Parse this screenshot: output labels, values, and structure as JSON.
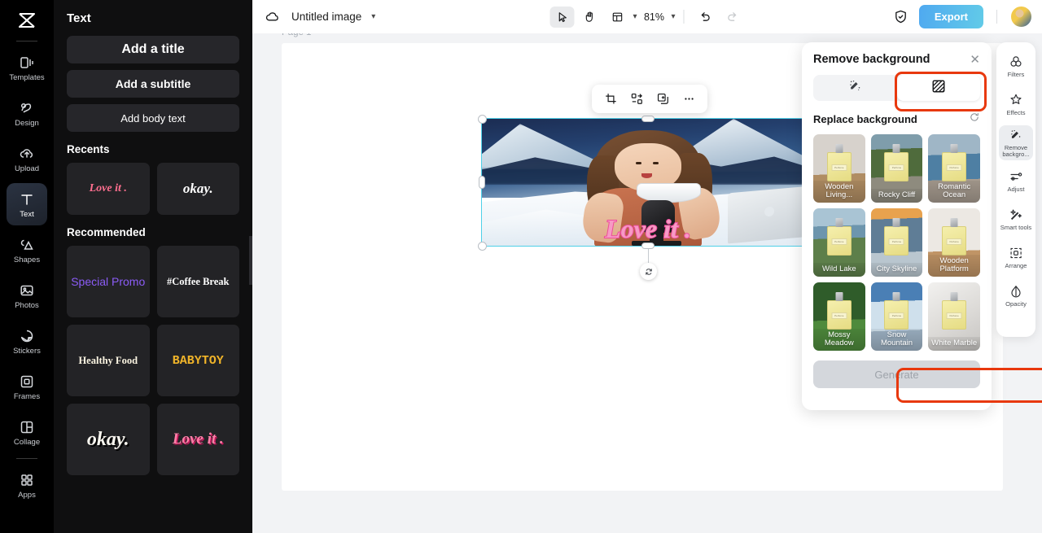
{
  "sidebar": {
    "logo_icon": "capcut-logo-icon",
    "items": [
      {
        "label": "Templates",
        "icon": "templates-icon",
        "active": false
      },
      {
        "label": "Design",
        "icon": "design-icon",
        "active": false
      },
      {
        "label": "Upload",
        "icon": "upload-cloud-icon",
        "active": false
      },
      {
        "label": "Text",
        "icon": "text-icon",
        "active": true
      },
      {
        "label": "Shapes",
        "icon": "shapes-icon",
        "active": false
      },
      {
        "label": "Photos",
        "icon": "photos-icon",
        "active": false
      },
      {
        "label": "Stickers",
        "icon": "stickers-icon",
        "active": false
      },
      {
        "label": "Frames",
        "icon": "frames-icon",
        "active": false
      },
      {
        "label": "Collage",
        "icon": "collage-icon",
        "active": false
      },
      {
        "label": "Apps",
        "icon": "apps-grid-icon",
        "active": false
      }
    ]
  },
  "text_panel": {
    "title": "Text",
    "buttons": [
      {
        "label": "Add a title"
      },
      {
        "label": "Add a subtitle"
      },
      {
        "label": "Add body text"
      }
    ],
    "recents_heading": "Recents",
    "recents": [
      {
        "label": "Love it .",
        "style": "pink-serif-italic"
      },
      {
        "label": "okay.",
        "style": "white-serif-italic"
      }
    ],
    "recommended_heading": "Recommended",
    "recommended": [
      {
        "label": "Special Promo",
        "style": "purple"
      },
      {
        "label": "#Coffee Break",
        "style": "white-serif"
      },
      {
        "label": "Healthy Food",
        "style": "cream-serif"
      },
      {
        "label": "BABYTOY",
        "style": "yellow-block"
      },
      {
        "label": "okay.",
        "style": "white-shadow-serif"
      },
      {
        "label": "Love it .",
        "style": "pink-shadow-serif"
      }
    ],
    "collapse_icon": "chevron-left-icon"
  },
  "topbar": {
    "cloud_icon": "cloud-save-icon",
    "doc_title": "Untitled image",
    "title_chevron_icon": "chevron-down-icon",
    "tools": [
      {
        "name": "select-tool",
        "icon": "cursor-arrow-icon",
        "selected": true
      },
      {
        "name": "hand-tool",
        "icon": "hand-icon",
        "selected": false
      },
      {
        "name": "layout-tool",
        "icon": "layout-panel-icon",
        "selected": false
      }
    ],
    "layout_chevron_icon": "chevron-down-icon",
    "zoom_level": "81%",
    "zoom_chevron_icon": "chevron-down-icon",
    "undo_icon": "undo-arrow-icon",
    "redo_icon": "redo-arrow-icon",
    "shield_icon": "shield-check-icon",
    "export_label": "Export",
    "avatar_icon": "user-avatar"
  },
  "canvas": {
    "page_label": "Page 1",
    "element_toolbar": [
      {
        "name": "crop-button",
        "icon": "crop-icon"
      },
      {
        "name": "cutout-button",
        "icon": "cutout-shapes-icon"
      },
      {
        "name": "duplicate-button",
        "icon": "duplicate-icon"
      },
      {
        "name": "more-options-button",
        "icon": "ellipsis-icon"
      }
    ],
    "selected_image": {
      "overlay_text": "Love it .",
      "description": "Woman holding a bowl with microphone and laptop on snowy mountain background"
    },
    "rotate_icon": "rotate-handle-icon"
  },
  "remove_background_panel": {
    "title": "Remove background",
    "close_icon": "close-icon",
    "tabs": [
      {
        "name": "auto-erase-tab",
        "icon": "magic-eraser-icon",
        "active": false
      },
      {
        "name": "replace-background-tab",
        "icon": "checkered-square-icon",
        "active": true
      }
    ],
    "section_title": "Replace background",
    "refresh_icon": "refresh-icon",
    "backgrounds": [
      {
        "label": "Wooden Living...",
        "scene": "wooden-living"
      },
      {
        "label": "Rocky Cliff",
        "scene": "rocky-cliff"
      },
      {
        "label": "Romantic Ocean",
        "scene": "romantic-ocean"
      },
      {
        "label": "Wild Lake",
        "scene": "wild-lake"
      },
      {
        "label": "City Skyline",
        "scene": "city-skyline"
      },
      {
        "label": "Wooden Platform",
        "scene": "wooden-platform"
      },
      {
        "label": "Mossy Meadow",
        "scene": "mossy-meadow"
      },
      {
        "label": "Snow Mountain",
        "scene": "snow-mountain"
      },
      {
        "label": "White Marble",
        "scene": "white-marble"
      }
    ],
    "generate_label": "Generate",
    "generate_disabled": true
  },
  "tool_rail": {
    "items": [
      {
        "label": "Filters",
        "icon": "filters-icon",
        "active": false
      },
      {
        "label": "Effects",
        "icon": "effects-star-icon",
        "active": false
      },
      {
        "label": "Remove backgro...",
        "icon": "magic-eraser-icon",
        "active": true
      },
      {
        "label": "Adjust",
        "icon": "sliders-icon",
        "active": false
      },
      {
        "label": "Smart tools",
        "icon": "magic-wand-icon",
        "active": false
      },
      {
        "label": "Arrange",
        "icon": "arrange-icon",
        "active": false
      },
      {
        "label": "Opacity",
        "icon": "opacity-drop-icon",
        "active": false
      }
    ]
  },
  "annotations": {
    "color": "#e8380d",
    "targets": [
      "replace-background-tab",
      "generate-button",
      "remove-background-tool"
    ]
  }
}
